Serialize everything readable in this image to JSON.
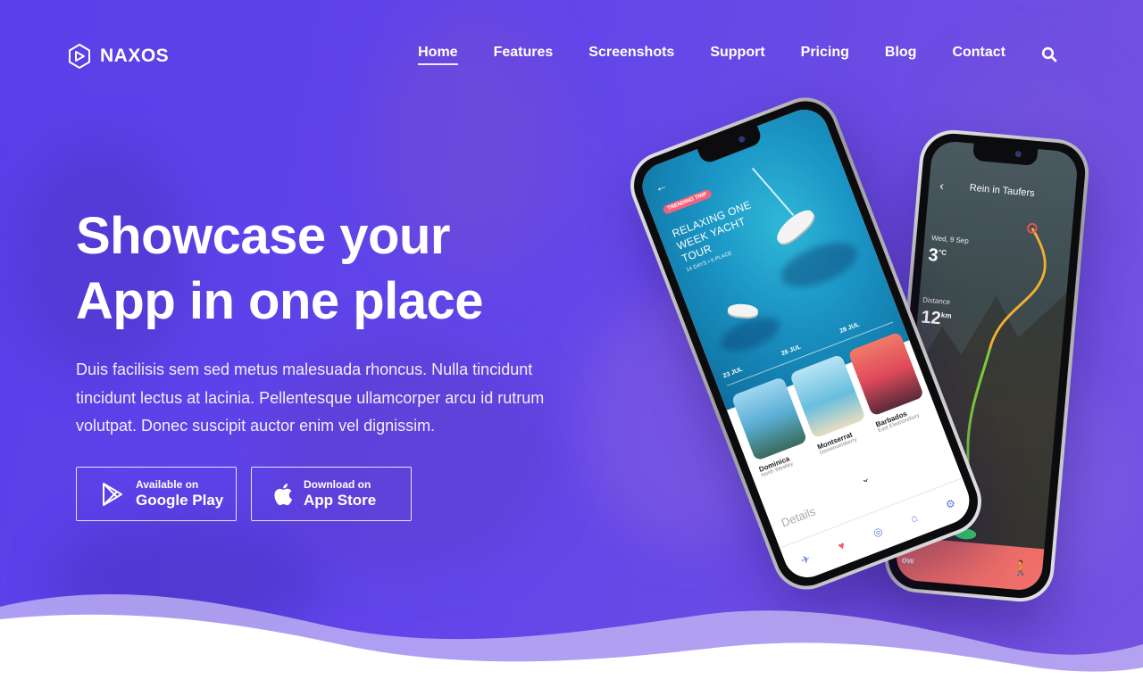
{
  "brand": {
    "name": "NAXOS"
  },
  "nav": {
    "items": [
      {
        "label": "Home",
        "active": true
      },
      {
        "label": "Features"
      },
      {
        "label": "Screenshots"
      },
      {
        "label": "Support"
      },
      {
        "label": "Pricing"
      },
      {
        "label": "Blog"
      },
      {
        "label": "Contact"
      }
    ],
    "search_icon": "search-icon"
  },
  "hero": {
    "title_line1": "Showcase your",
    "title_line2": "App in one place",
    "description": "Duis facilisis sem sed metus malesuada rhoncus. Nulla tincidunt tincidunt lectus at lacinia. Pellentesque ullamcorper arcu id rutrum volutpat. Donec suscipit auctor enim vel dignissim."
  },
  "buttons": {
    "google": {
      "small": "Available on",
      "big": "Google Play",
      "icon": "google-play-icon"
    },
    "apple": {
      "small": "Download on",
      "big": "App Store",
      "icon": "apple-icon"
    }
  },
  "phone_front": {
    "badge": "TRENDING TRIP",
    "title": "RELAXING ONE WEEK YACHT TOUR",
    "meta": "14 DAYS • 6 PLACE",
    "dates": [
      "23 JUL",
      "26 JUL",
      "28 JUL"
    ],
    "cards": [
      {
        "name": "Dominica",
        "sub": "North Westley"
      },
      {
        "name": "Montserrat",
        "sub": "Demenuelsberry"
      },
      {
        "name": "Barbados",
        "sub": "East Eleanorebury"
      }
    ],
    "details": "Details"
  },
  "phone_back": {
    "title": "Rein in Taufers",
    "date": "Wed, 9 Sep",
    "temp": "3",
    "temp_unit": "°C",
    "distance_label": "Distance",
    "distance": "12",
    "distance_unit": "km",
    "bar_text": "ow"
  },
  "colors": {
    "primary": "#6246ea",
    "accent_red": "#f06f6a",
    "white": "#ffffff"
  }
}
